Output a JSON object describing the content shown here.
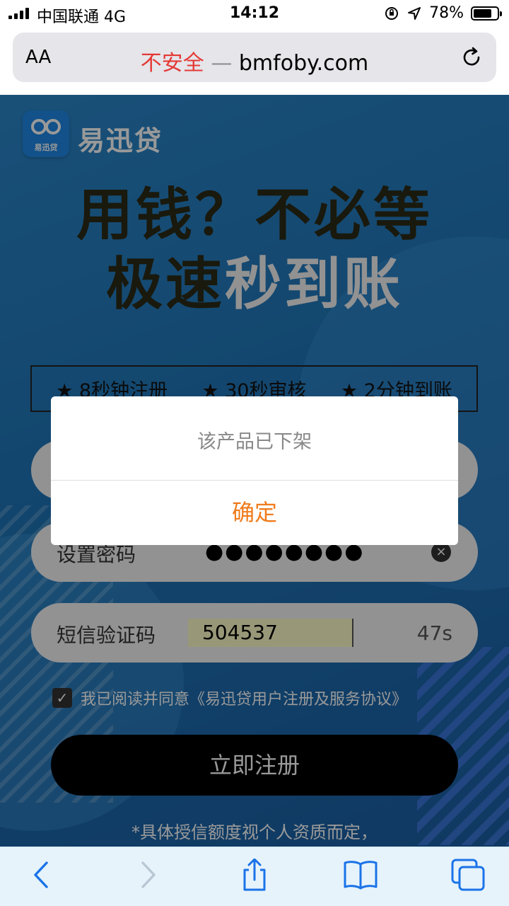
{
  "status_bar": {
    "carrier": "中国联通 4G",
    "time": "14:12",
    "battery_percent": "78%",
    "battery_level": 0.78
  },
  "address_bar": {
    "aa_label": "AA",
    "insecure_label": "不安全",
    "separator": "—",
    "domain": "bmfoby.com"
  },
  "page": {
    "logo_text": "易迅贷",
    "brand_name": "易迅贷",
    "headline_line1": "用钱？不必等",
    "headline_line2_dark": "极速",
    "headline_line2_light": "秒到账",
    "features": [
      "★ 8秒钟注册",
      "★ 30秒审核",
      "★ 2分钟到账"
    ],
    "password_label": "设置密码",
    "password_value": "●●●●●●●●",
    "sms_label": "短信验证码",
    "sms_code": "504537",
    "countdown": "47s",
    "agreement": "我已阅读并同意《易迅贷用户注册及服务协议》",
    "register_button": "立即注册",
    "note": "*具体授信额度视个人资质而定，"
  },
  "dialog": {
    "message": "该产品已下架",
    "confirm": "确定"
  },
  "colors": {
    "insecure": "#e53935",
    "confirm": "#f07c1d",
    "page_bg": "#2076b8",
    "toolbar_icon": "#1a73e8"
  }
}
